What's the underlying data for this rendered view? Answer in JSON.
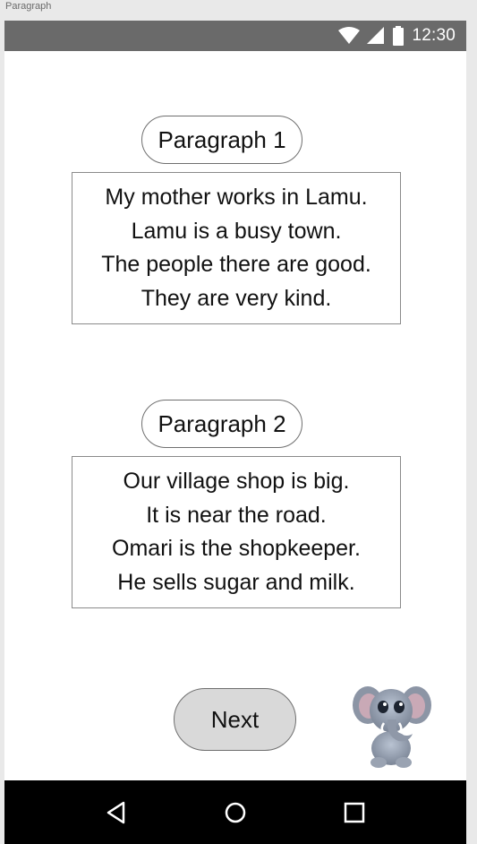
{
  "window": {
    "label": "Paragraph"
  },
  "status_bar": {
    "time": "12:30",
    "icons": [
      "wifi-icon",
      "cell-signal-icon",
      "battery-icon"
    ]
  },
  "paragraphs": [
    {
      "title": "Paragraph 1",
      "lines": [
        "My mother works in Lamu.",
        "Lamu is a busy town.",
        "The people there are good.",
        "They are very kind."
      ]
    },
    {
      "title": "Paragraph 2",
      "lines": [
        "Our village shop is big.",
        "It is near the road.",
        "Omari is the shopkeeper.",
        "He sells sugar and milk."
      ]
    }
  ],
  "actions": {
    "next_label": "Next"
  },
  "mascot": {
    "icon": "elephant-mascot-icon"
  },
  "nav_bar": {
    "icons": [
      "back-icon",
      "home-icon",
      "recents-icon"
    ]
  },
  "colors": {
    "status_bar": "#6a6a6a",
    "nav_bar": "#000000",
    "next_button": "#d9d9d9",
    "border": "#8a8a8a"
  }
}
